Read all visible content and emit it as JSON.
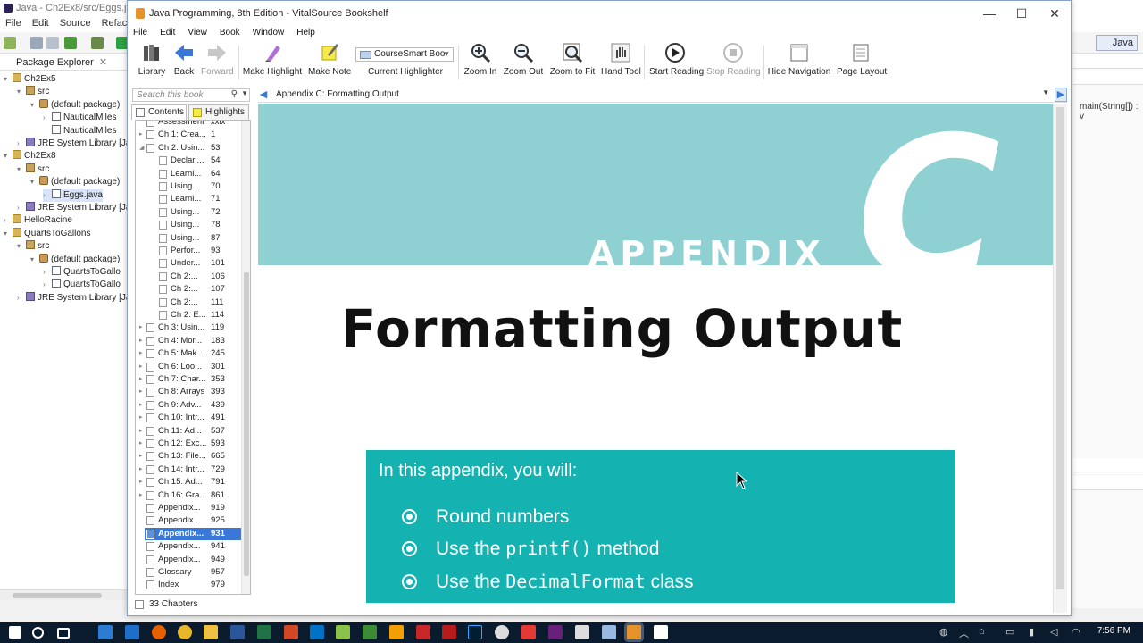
{
  "eclipse": {
    "title": "Java - Ch2Ex8/src/Eggs.java -",
    "menu": [
      "File",
      "Edit",
      "Source",
      "Refactor"
    ],
    "perspective": "Java",
    "package_explorer": {
      "title": "Package Explorer",
      "items": [
        {
          "label": "Ch2Ex5",
          "icon": "project-icon",
          "arrow": "▾"
        },
        {
          "label": "src",
          "icon": "src-folder-icon",
          "arrow": "▾"
        },
        {
          "label": "(default package)",
          "icon": "package-icon",
          "arrow": "▾"
        },
        {
          "label": "NauticalMiles",
          "icon": "java-file-icon",
          "arrow": "›"
        },
        {
          "label": "NauticalMiles",
          "icon": "java-file-icon",
          "arrow": ""
        },
        {
          "label": "JRE System Library [Ja",
          "icon": "library-icon",
          "arrow": "›"
        },
        {
          "label": "Ch2Ex8",
          "icon": "project-icon",
          "arrow": "▾"
        },
        {
          "label": "src",
          "icon": "src-folder-icon",
          "arrow": "▾"
        },
        {
          "label": "(default package)",
          "icon": "package-icon",
          "arrow": "▾"
        },
        {
          "label": "Eggs.java",
          "icon": "java-file-icon",
          "arrow": "›",
          "selected": true
        },
        {
          "label": "JRE System Library [Ja",
          "icon": "library-icon",
          "arrow": "›"
        },
        {
          "label": "HelloRacine",
          "icon": "project-icon",
          "arrow": "›"
        },
        {
          "label": "QuartsToGallons",
          "icon": "project-icon",
          "arrow": "▾"
        },
        {
          "label": "src",
          "icon": "src-folder-icon",
          "arrow": "▾"
        },
        {
          "label": "(default package)",
          "icon": "package-icon",
          "arrow": "▾"
        },
        {
          "label": "QuartsToGallo",
          "icon": "java-file-icon",
          "arrow": "›"
        },
        {
          "label": "QuartsToGallo",
          "icon": "java-file-icon",
          "arrow": "›"
        },
        {
          "label": "JRE System Library [Ja",
          "icon": "library-icon",
          "arrow": "›"
        }
      ]
    },
    "outline_item": "main(String[]) : v"
  },
  "vitalsource": {
    "window_title": "Java Programming,  8th Edition - VitalSource Bookshelf",
    "menu": [
      "File",
      "Edit",
      "View",
      "Book",
      "Window",
      "Help"
    ],
    "toolbar": {
      "library": "Library",
      "back": "Back",
      "forward": "Forward",
      "make_highlight": "Make Highlight",
      "make_note": "Make Note",
      "highlighter_value": "CourseSmart Boo",
      "current_highlighter": "Current Highlighter",
      "zoom_in": "Zoom In",
      "zoom_out": "Zoom Out",
      "zoom_to_fit": "Zoom to Fit",
      "hand_tool": "Hand Tool",
      "start_reading": "Start Reading",
      "stop_reading": "Stop Reading",
      "hide_navigation": "Hide Navigation",
      "page_layout": "Page Layout"
    },
    "search_placeholder": "Search this book",
    "tabs": {
      "contents": "Contents",
      "highlights": "Highlights"
    },
    "toc": [
      {
        "label": "Assessment",
        "page": "xxix",
        "level": 0,
        "arrow": ""
      },
      {
        "label": "Ch 1: Crea...",
        "page": "1",
        "level": 0,
        "arrow": "▸"
      },
      {
        "label": "Ch 2: Usin...",
        "page": "53",
        "level": 0,
        "arrow": "◢"
      },
      {
        "label": "Declari...",
        "page": "54",
        "level": 1,
        "arrow": ""
      },
      {
        "label": "Learni...",
        "page": "64",
        "level": 1,
        "arrow": ""
      },
      {
        "label": "Using...",
        "page": "70",
        "level": 1,
        "arrow": ""
      },
      {
        "label": "Learni...",
        "page": "71",
        "level": 1,
        "arrow": ""
      },
      {
        "label": "Using...",
        "page": "72",
        "level": 1,
        "arrow": ""
      },
      {
        "label": "Using...",
        "page": "78",
        "level": 1,
        "arrow": ""
      },
      {
        "label": "Using...",
        "page": "87",
        "level": 1,
        "arrow": ""
      },
      {
        "label": "Perfor...",
        "page": "93",
        "level": 1,
        "arrow": ""
      },
      {
        "label": "Under...",
        "page": "101",
        "level": 1,
        "arrow": ""
      },
      {
        "label": "Ch 2:...",
        "page": "106",
        "level": 1,
        "arrow": ""
      },
      {
        "label": "Ch 2:...",
        "page": "107",
        "level": 1,
        "arrow": ""
      },
      {
        "label": "Ch 2:...",
        "page": "111",
        "level": 1,
        "arrow": ""
      },
      {
        "label": "Ch 2: E...",
        "page": "114",
        "level": 1,
        "arrow": ""
      },
      {
        "label": "Ch 3: Usin...",
        "page": "119",
        "level": 0,
        "arrow": "▸"
      },
      {
        "label": "Ch 4: Mor...",
        "page": "183",
        "level": 0,
        "arrow": "▸"
      },
      {
        "label": "Ch 5: Mak...",
        "page": "245",
        "level": 0,
        "arrow": "▸"
      },
      {
        "label": "Ch 6: Loo...",
        "page": "301",
        "level": 0,
        "arrow": "▸"
      },
      {
        "label": "Ch 7: Char...",
        "page": "353",
        "level": 0,
        "arrow": "▸"
      },
      {
        "label": "Ch 8: Arrays",
        "page": "393",
        "level": 0,
        "arrow": "▸"
      },
      {
        "label": "Ch 9: Adv...",
        "page": "439",
        "level": 0,
        "arrow": "▸"
      },
      {
        "label": "Ch 10: Intr...",
        "page": "491",
        "level": 0,
        "arrow": "▸"
      },
      {
        "label": "Ch 11: Ad...",
        "page": "537",
        "level": 0,
        "arrow": "▸"
      },
      {
        "label": "Ch 12: Exc...",
        "page": "593",
        "level": 0,
        "arrow": "▸"
      },
      {
        "label": "Ch 13: File...",
        "page": "665",
        "level": 0,
        "arrow": "▸"
      },
      {
        "label": "Ch 14: Intr...",
        "page": "729",
        "level": 0,
        "arrow": "▸"
      },
      {
        "label": "Ch 15: Ad...",
        "page": "791",
        "level": 0,
        "arrow": "▸"
      },
      {
        "label": "Ch 16: Gra...",
        "page": "861",
        "level": 0,
        "arrow": "▸"
      },
      {
        "label": "Appendix...",
        "page": "919",
        "level": 0,
        "arrow": ""
      },
      {
        "label": "Appendix...",
        "page": "925",
        "level": 0,
        "arrow": ""
      },
      {
        "label": "Appendix...",
        "page": "931",
        "level": 0,
        "arrow": "",
        "selected": true
      },
      {
        "label": "Appendix...",
        "page": "941",
        "level": 0,
        "arrow": ""
      },
      {
        "label": "Appendix...",
        "page": "949",
        "level": 0,
        "arrow": ""
      },
      {
        "label": "Glossary",
        "page": "957",
        "level": 0,
        "arrow": ""
      },
      {
        "label": "Index",
        "page": "979",
        "level": 0,
        "arrow": ""
      }
    ],
    "chapters_count": "33 Chapters",
    "location": "Appendix C: Formatting Output",
    "page": {
      "appendix_word": "APPENDIX",
      "appendix_letter": "C",
      "title": "Formatting Output",
      "intro": "In this appendix, you will:",
      "objectives": [
        {
          "before": "Round numbers",
          "code": "",
          "after": ""
        },
        {
          "before": "Use the ",
          "code": "printf()",
          "after": " method"
        },
        {
          "before": "Use the ",
          "code": "DecimalFormat",
          "after": " class"
        }
      ]
    },
    "colors": {
      "banner": "#8fd1d2",
      "objectives_box": "#14b3b1",
      "selection": "#3a78d8"
    }
  },
  "taskbar": {
    "time": "7:56 PM"
  }
}
